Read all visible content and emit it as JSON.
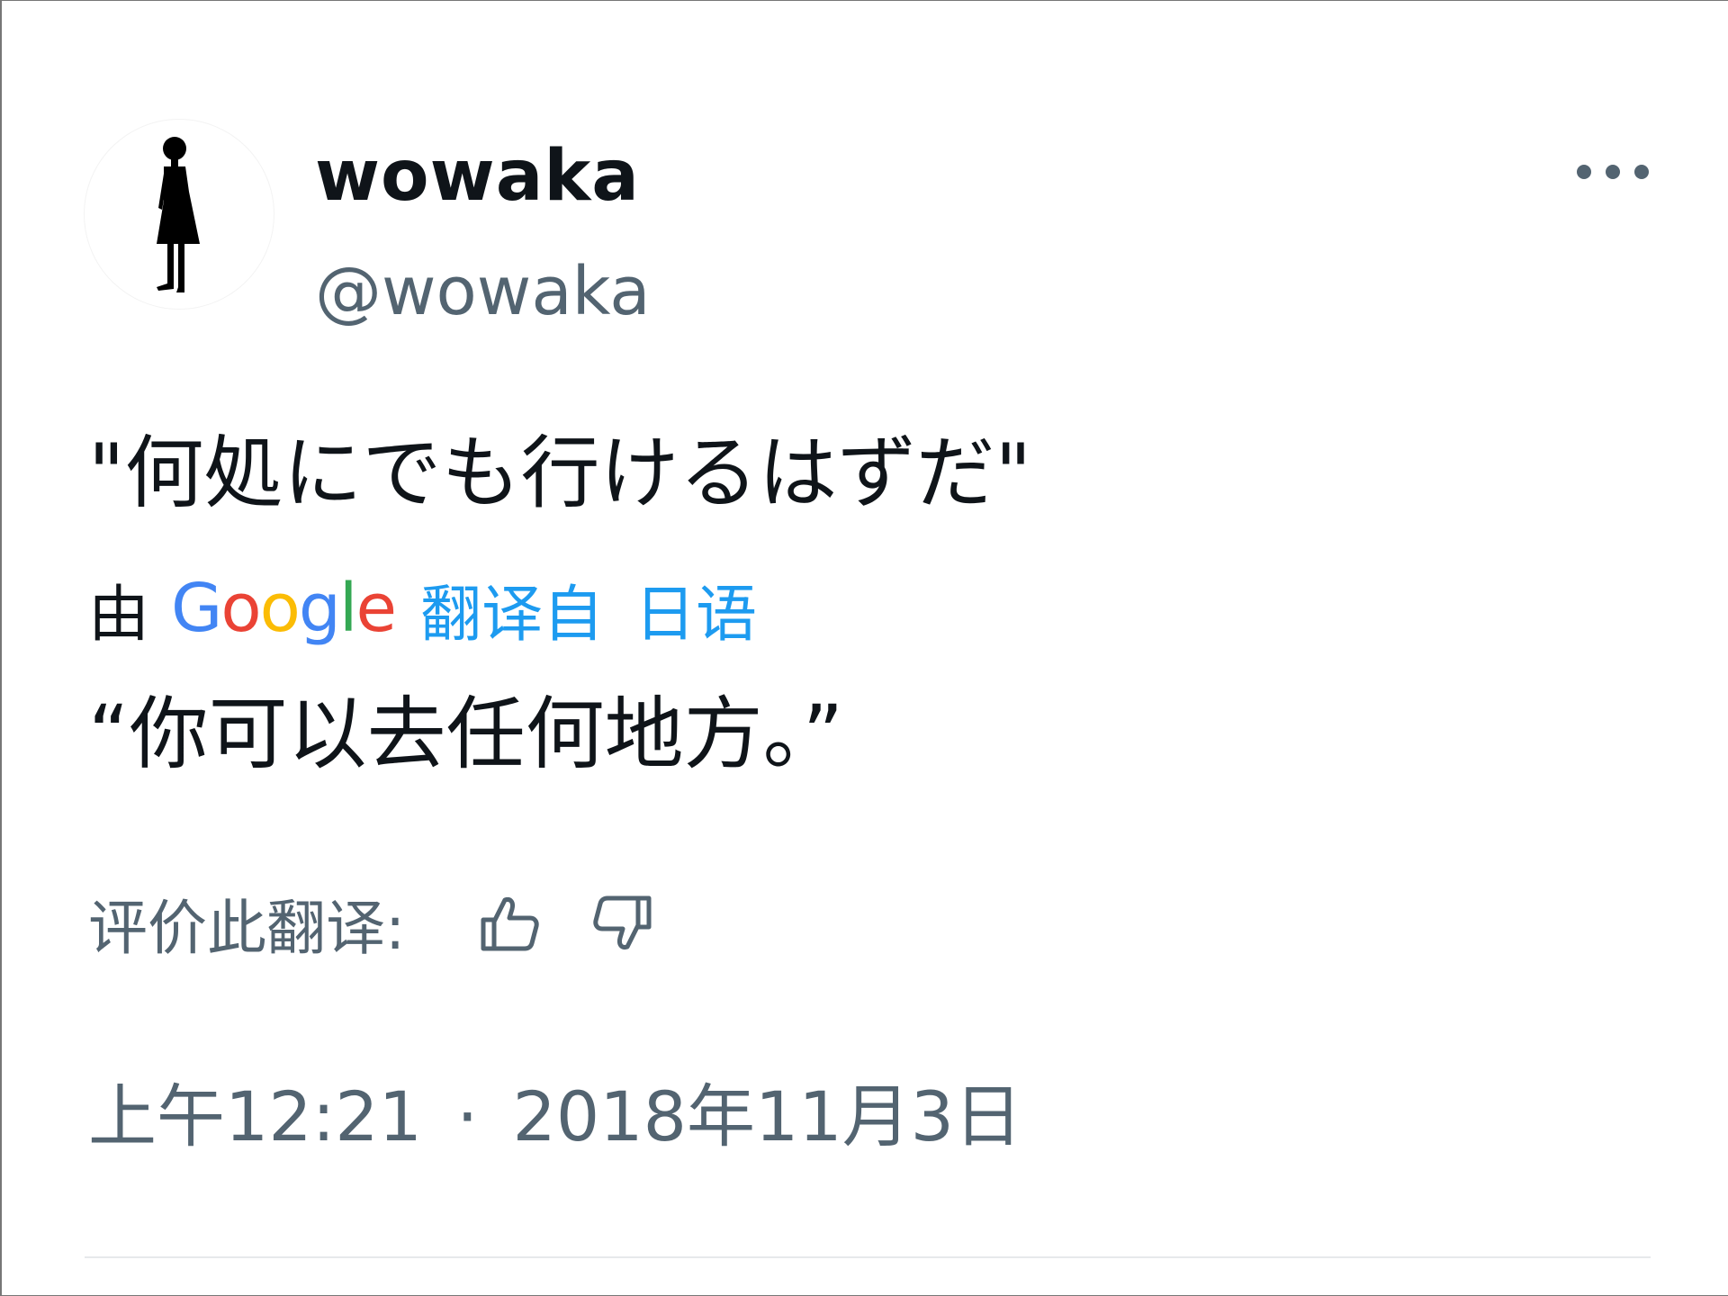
{
  "user": {
    "display_name": "wowaka",
    "handle": "@wowaka",
    "avatar_icon": "silhouette-figure-icon"
  },
  "header": {
    "more_icon": "more-horizontal-icon"
  },
  "tweet": {
    "original_text": "\"何処にでも行けるはずだ\"",
    "translation": {
      "by_label": "由",
      "provider_letters": [
        "G",
        "o",
        "o",
        "g",
        "l",
        "e"
      ],
      "provider_colors": [
        "#4285F4",
        "#EA4335",
        "#FBBC05",
        "#4285F4",
        "#34A853",
        "#EA4335"
      ],
      "link_label": "翻译自",
      "language_label": "日语",
      "translated_text": "“你可以去任何地方。”"
    },
    "rating": {
      "label": "评价此翻译:",
      "thumbs_up_icon": "thumbs-up-icon",
      "thumbs_down_icon": "thumbs-down-icon"
    },
    "timestamp": {
      "time": "上午12:21",
      "separator": "·",
      "date": "2018年11月3日"
    }
  },
  "colors": {
    "text_primary": "#0f1419",
    "text_secondary": "#536471",
    "link": "#1d9bf0",
    "divider": "#e6e9eb"
  }
}
